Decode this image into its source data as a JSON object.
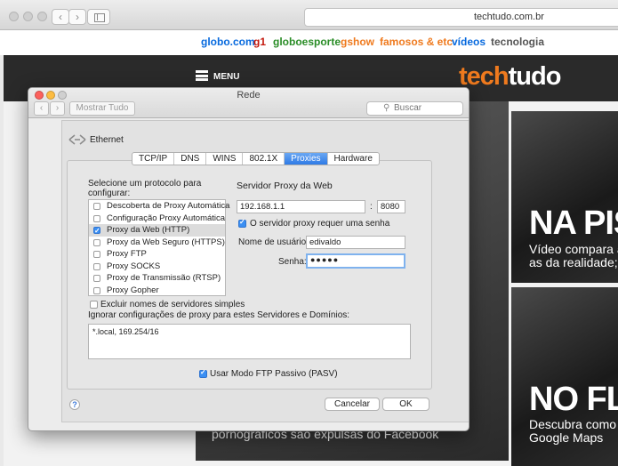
{
  "browser": {
    "url_text": "techtudo.com.br",
    "back_icon": "chevron-left-icon",
    "forward_icon": "chevron-right-icon"
  },
  "globo_nav": {
    "links": [
      {
        "label": "globo.com",
        "color": "#0669de"
      },
      {
        "label": "g1",
        "color": "#c4170c"
      },
      {
        "label": "globoesporte",
        "color": "#2a8d27"
      },
      {
        "label": "gshow",
        "color": "#ef7a1e"
      },
      {
        "label": "famosos & etc",
        "color": "#ef7a1e"
      },
      {
        "label": "vídeos",
        "color": "#0669de"
      },
      {
        "label": "tecnologia",
        "color": "#555555"
      }
    ]
  },
  "site": {
    "menu_label": "MENU",
    "logo_part1": "tech",
    "logo_part2": "tudo",
    "accent": "#ef7a1e"
  },
  "stories": {
    "left_caption": "pornográficos são expulsas do Facebook",
    "top_right": {
      "headline": "NA PIS",
      "sub1": "Vídeo compara a",
      "sub2": "as da realidade; c"
    },
    "bottom_right": {
      "headline": "NO FLA",
      "sub1": "Descubra como a",
      "sub2": "Google Maps"
    }
  },
  "dialog": {
    "title": "Rede",
    "show_all": "Mostrar Tudo",
    "search_placeholder": "Buscar",
    "interface_name": "Ethernet",
    "tabs": [
      {
        "label": "TCP/IP",
        "active": false
      },
      {
        "label": "DNS",
        "active": false
      },
      {
        "label": "WINS",
        "active": false
      },
      {
        "label": "802.1X",
        "active": false
      },
      {
        "label": "Proxies",
        "active": true
      },
      {
        "label": "Hardware",
        "active": false
      }
    ],
    "protocol_prompt_line1": "Selecione um protocolo para",
    "protocol_prompt_line2": "configurar:",
    "protocols": [
      {
        "label": "Descoberta de Proxy Automática",
        "checked": false,
        "selected": false
      },
      {
        "label": "Configuração Proxy Automática",
        "checked": false,
        "selected": false
      },
      {
        "label": "Proxy da Web (HTTP)",
        "checked": true,
        "selected": true
      },
      {
        "label": "Proxy da Web Seguro (HTTPS)",
        "checked": false,
        "selected": false
      },
      {
        "label": "Proxy FTP",
        "checked": false,
        "selected": false
      },
      {
        "label": "Proxy SOCKS",
        "checked": false,
        "selected": false
      },
      {
        "label": "Proxy de Transmissão (RTSP)",
        "checked": false,
        "selected": false
      },
      {
        "label": "Proxy Gopher",
        "checked": false,
        "selected": false
      }
    ],
    "proxy_server_label": "Servidor Proxy da Web",
    "proxy_host": "192.168.1.1",
    "port_separator": ":",
    "proxy_port": "8080",
    "requires_password_label": "O servidor proxy requer uma senha",
    "requires_password_checked": true,
    "username_label": "Nome de usuário:",
    "username_value": "edivaldo",
    "password_label": "Senha:",
    "password_mask": "●●●●●",
    "exclude_simple_label": "Excluir nomes de servidores simples",
    "exclude_simple_checked": false,
    "bypass_label": "Ignorar configurações de proxy para estes Servidores e Domínios:",
    "bypass_value": "*.local, 169.254/16",
    "passive_ftp_label": "Usar Modo FTP Passivo (PASV)",
    "passive_ftp_checked": true,
    "help_label": "?",
    "cancel_label": "Cancelar",
    "ok_label": "OK"
  }
}
